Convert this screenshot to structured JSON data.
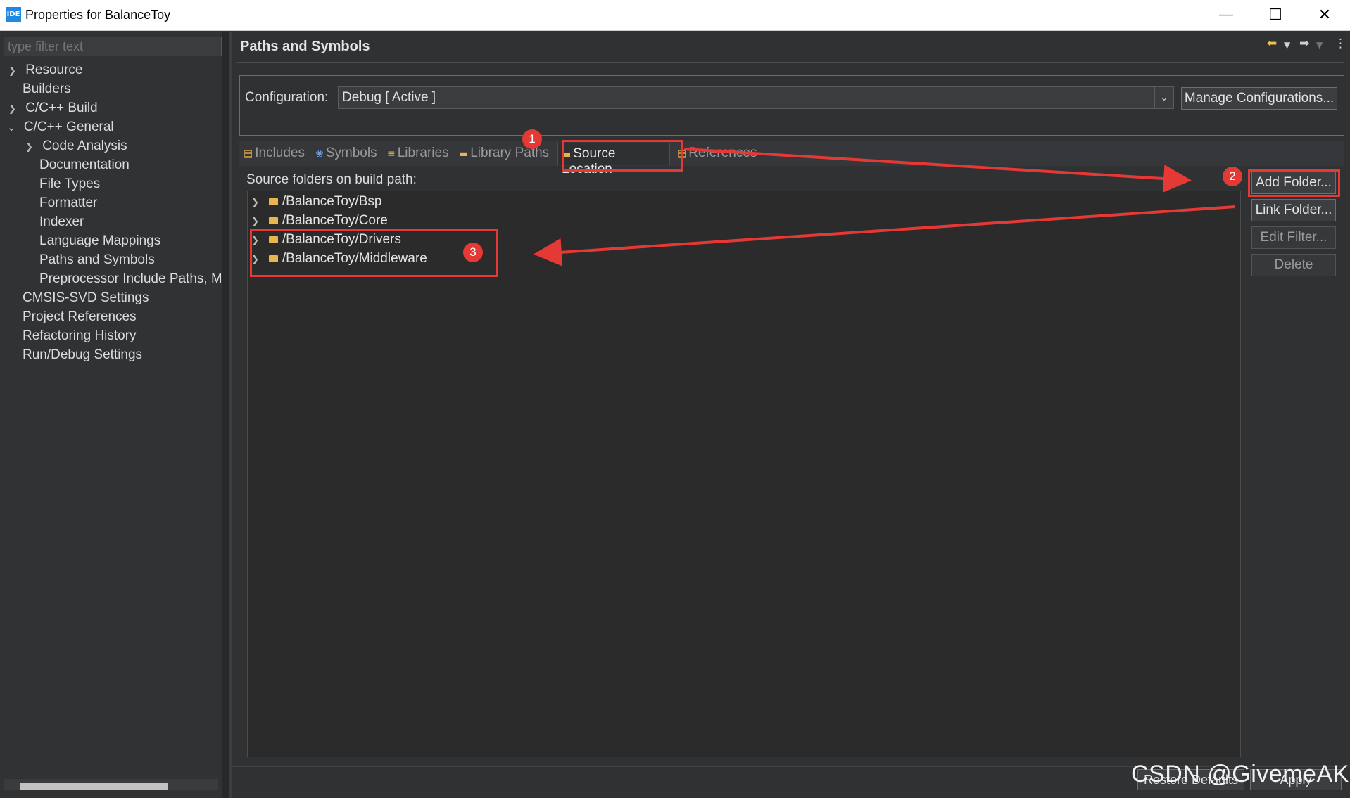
{
  "window": {
    "app_icon": "IDE",
    "title": "Properties for BalanceToy",
    "minimize_icon": "minimize-icon",
    "maximize_icon": "maximize-icon",
    "close_icon": "close-icon"
  },
  "sidebar": {
    "filter_placeholder": "type filter text",
    "items": [
      {
        "label": "Resource",
        "expander": ">"
      },
      {
        "label": "Builders",
        "expander": ""
      },
      {
        "label": "C/C++ Build",
        "expander": ">"
      },
      {
        "label": "C/C++ General",
        "expander": "v"
      },
      {
        "label": "Code Analysis",
        "expander": ">"
      },
      {
        "label": "Documentation",
        "expander": ""
      },
      {
        "label": "File Types",
        "expander": ""
      },
      {
        "label": "Formatter",
        "expander": ""
      },
      {
        "label": "Indexer",
        "expander": ""
      },
      {
        "label": "Language Mappings",
        "expander": ""
      },
      {
        "label": "Paths and Symbols",
        "expander": ""
      },
      {
        "label": "Preprocessor Include Paths, Ma",
        "expander": ""
      },
      {
        "label": "CMSIS-SVD Settings",
        "expander": ""
      },
      {
        "label": "Project References",
        "expander": ""
      },
      {
        "label": "Refactoring History",
        "expander": ""
      },
      {
        "label": "Run/Debug Settings",
        "expander": ""
      }
    ]
  },
  "header": {
    "title": "Paths and Symbols",
    "nav_icons": [
      "back-arrow-icon",
      "dropdown-icon",
      "forward-arrow-icon",
      "dropdown-icon",
      "more-vertical-icon"
    ]
  },
  "config": {
    "label": "Configuration:",
    "value": "Debug  [ Active ]",
    "manage_label": "Manage Configurations..."
  },
  "tabs": [
    {
      "label": "Includes",
      "icon": "includes-icon",
      "active": false
    },
    {
      "label": "Symbols",
      "icon": "symbols-icon",
      "active": false
    },
    {
      "label": "Libraries",
      "icon": "libraries-icon",
      "active": false
    },
    {
      "label": "Library Paths",
      "icon": "library-paths-icon",
      "active": false
    },
    {
      "label": "Source Location",
      "icon": "source-location-icon",
      "active": true
    },
    {
      "label": "References",
      "icon": "references-icon",
      "active": false
    }
  ],
  "source": {
    "label": "Source folders on build path:",
    "folders": [
      "/BalanceToy/Bsp",
      "/BalanceToy/Core",
      "/BalanceToy/Drivers",
      "/BalanceToy/Middleware"
    ]
  },
  "side_buttons": {
    "add_folder": "Add Folder...",
    "link_folder": "Link Folder...",
    "edit_filter": "Edit Filter...",
    "delete": "Delete"
  },
  "bottom": {
    "restore_defaults": "Restore Defaults",
    "apply": "Apply"
  },
  "annotations": {
    "badge_1": "1",
    "badge_2": "2",
    "badge_3": "3",
    "color": "#e53935"
  },
  "watermark": "CSDN @GivemeAK"
}
